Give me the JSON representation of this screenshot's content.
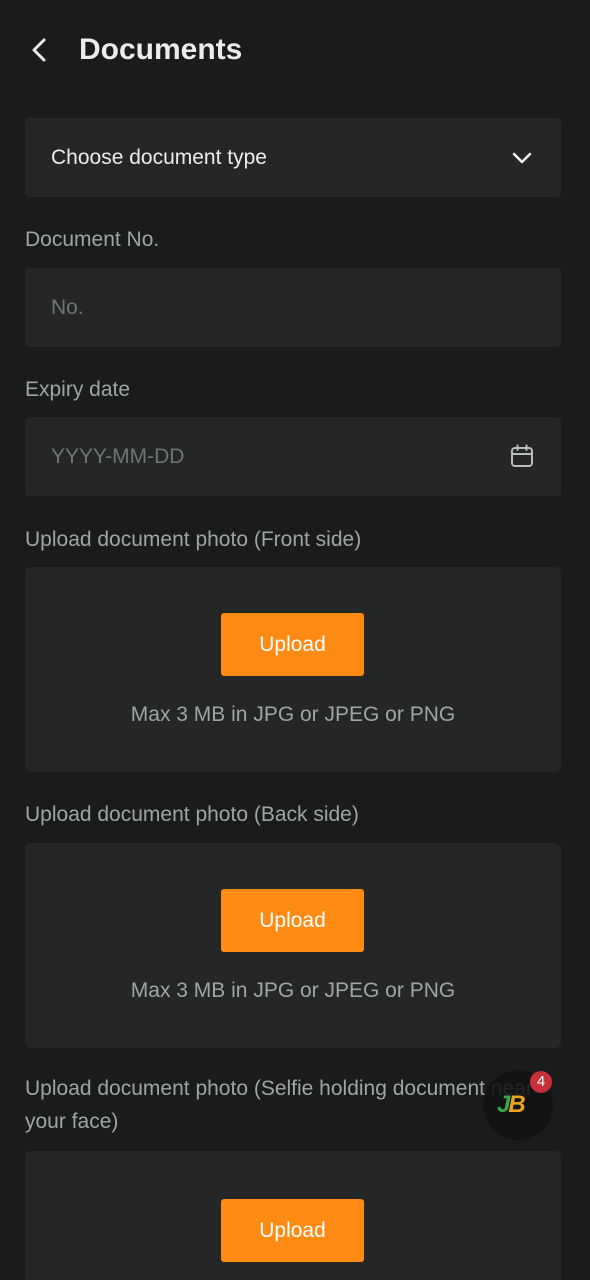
{
  "header": {
    "title": "Documents",
    "back_icon": "chevron-left-icon"
  },
  "document_type": {
    "value": "Choose document type",
    "icon": "chevron-down-icon"
  },
  "document_no": {
    "label": "Document No.",
    "placeholder": "No.",
    "value": ""
  },
  "expiry": {
    "label": "Expiry date",
    "placeholder": "YYYY-MM-DD",
    "value": "",
    "icon": "calendar-icon"
  },
  "uploads": [
    {
      "label": "Upload document photo (Front side)",
      "button": "Upload",
      "hint": "Max 3 MB in JPG or JPEG or PNG"
    },
    {
      "label": "Upload document photo (Back side)",
      "button": "Upload",
      "hint": "Max 3 MB in JPG or JPEG or PNG"
    },
    {
      "label": "Upload document photo (Selfie holding document near your face)",
      "button": "Upload"
    }
  ],
  "floating_badge": {
    "logo_part1": "J",
    "logo_part2": "B",
    "count": "4"
  },
  "colors": {
    "background": "#1a1b1b",
    "surface": "#252727",
    "accent": "#ff8a14",
    "badge": "#c9303a"
  }
}
